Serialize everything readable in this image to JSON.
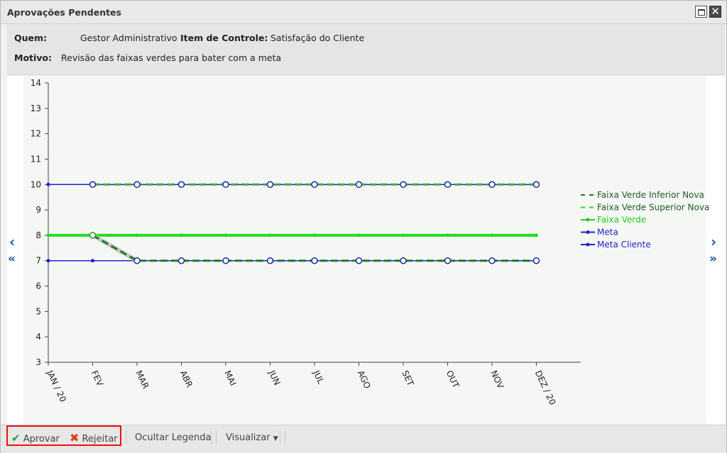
{
  "window": {
    "title": "Aprovações Pendentes"
  },
  "info": {
    "quem_label": "Quem:",
    "quem_value": "Gestor Administrativo",
    "item_label": "Item de Controle:",
    "item_value": "Satisfação do Cliente",
    "motivo_label": "Motivo:",
    "motivo_value": "Revisão das faixas verdes para bater com a meta"
  },
  "toolbar": {
    "approve_label": "Aprovar",
    "reject_label": "Rejeitar",
    "hide_legend_label": "Ocultar Legenda",
    "view_label": "Visualizar"
  },
  "icons": {
    "approve": "checkmark-icon",
    "reject": "x-icon",
    "view_dropdown": "caret-down-icon"
  },
  "colors": {
    "green_dark": "#1e7a2e",
    "green_light": "#2ed62e",
    "blue": "#2222cc",
    "red": "#e11111"
  },
  "chart_data": {
    "type": "line",
    "categories": [
      "JAN / 20",
      "FEV",
      "MAR",
      "ABR",
      "MAI",
      "JUN",
      "JUL",
      "AGO",
      "SET",
      "OUT",
      "NOV",
      "DEZ / 20"
    ],
    "ylim": [
      3,
      14
    ],
    "yticks": [
      3,
      4,
      5,
      6,
      7,
      8,
      9,
      10,
      11,
      12,
      13,
      14
    ],
    "legend_position": "right",
    "series": [
      {
        "name": "Faixa Verde Inferior Nova",
        "style": "dashed",
        "color": "#1e7a2e",
        "values": [
          null,
          8,
          7,
          7,
          7,
          7,
          7,
          7,
          7,
          7,
          7,
          7
        ]
      },
      {
        "name": "Faixa Verde Superior Nova",
        "style": "dashed",
        "color": "#2ed62e",
        "values": [
          null,
          10,
          10,
          10,
          10,
          10,
          10,
          10,
          10,
          10,
          10,
          10
        ]
      },
      {
        "name": "Faixa Verde",
        "style": "solid",
        "color": "#22dd22",
        "values": [
          8,
          8,
          8,
          8,
          8,
          8,
          8,
          8,
          8,
          8,
          8,
          8
        ]
      },
      {
        "name": "Meta",
        "style": "solid",
        "color": "#2222cc",
        "values": [
          10,
          10,
          10,
          10,
          10,
          10,
          10,
          10,
          10,
          10,
          10,
          10
        ]
      },
      {
        "name": "Meta Cliente",
        "style": "solid",
        "color": "#2222cc",
        "values": [
          7,
          7,
          7,
          7,
          7,
          7,
          7,
          7,
          7,
          7,
          7,
          7
        ]
      }
    ]
  }
}
